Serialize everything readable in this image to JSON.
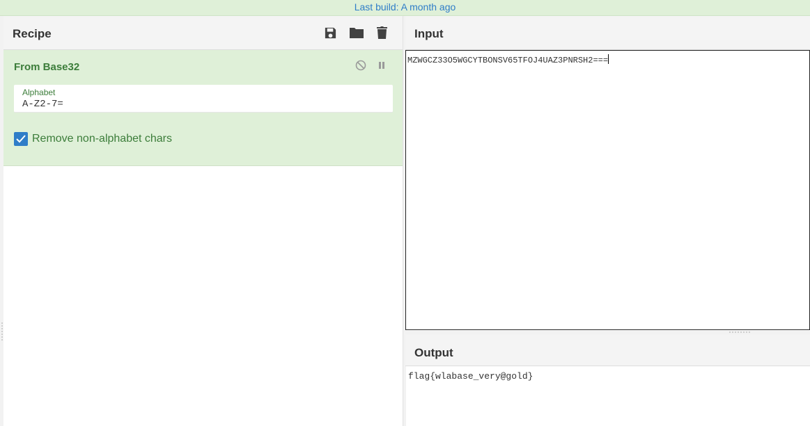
{
  "banner": {
    "text": "Last build: A month ago"
  },
  "recipe": {
    "title": "Recipe",
    "icons": [
      "save-icon",
      "folder-icon",
      "trash-icon"
    ],
    "operation": {
      "name": "From Base32",
      "controls": [
        "disable-icon",
        "pause-icon"
      ],
      "alphabet_label": "Alphabet",
      "alphabet_value": "A-Z2-7=",
      "remove_label": "Remove non-alphabet chars",
      "remove_checked": true
    }
  },
  "input": {
    "title": "Input",
    "text": "MZWGCZ33O5WGCYTBONSV65TFOJ4UAZ3PNRSH2==="
  },
  "output": {
    "title": "Output",
    "text": "flag{wlabase_very@gold}"
  },
  "colors": {
    "banner_bg": "#dff0d8",
    "link": "#2f7dc8",
    "operation_bg": "#dff0d8",
    "operation_text": "#3c7d3a",
    "checkbox": "#2f7dc8"
  }
}
